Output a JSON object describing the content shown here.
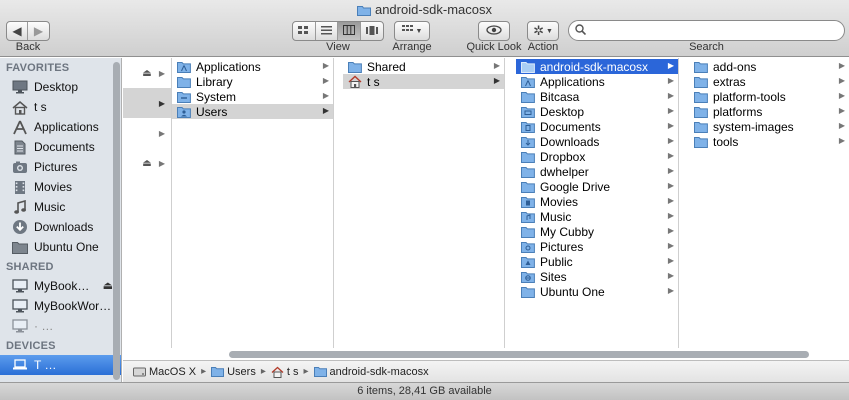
{
  "window": {
    "title": "android-sdk-macosx"
  },
  "toolbar": {
    "back_label": "Back",
    "view_label": "View",
    "arrange_label": "Arrange",
    "quicklook_label": "Quick Look",
    "action_label": "Action",
    "search_label": "Search",
    "search_placeholder": ""
  },
  "sidebar": {
    "favorites_header": "FAVORITES",
    "favorites": [
      {
        "label": "Desktop",
        "icon": "desktop-icon"
      },
      {
        "label": "t                 s",
        "icon": "home-icon"
      },
      {
        "label": "Applications",
        "icon": "applications-icon"
      },
      {
        "label": "Documents",
        "icon": "documents-icon"
      },
      {
        "label": "Pictures",
        "icon": "pictures-icon"
      },
      {
        "label": "Movies",
        "icon": "movies-icon"
      },
      {
        "label": "Music",
        "icon": "music-icon"
      },
      {
        "label": "Downloads",
        "icon": "downloads-icon"
      },
      {
        "label": "Ubuntu One",
        "icon": "folder-icon"
      }
    ],
    "shared_header": "SHARED",
    "shared": [
      {
        "label": "MyBook…",
        "icon": "computer-icon"
      },
      {
        "label": "MyBookWor…",
        "icon": "computer-icon"
      },
      {
        "label": "·            …",
        "icon": "computer-icon"
      }
    ],
    "devices_header": "DEVICES",
    "devices": [
      {
        "label": "T                …",
        "icon": "laptop-icon"
      }
    ]
  },
  "columns": {
    "volumes_arrow": "▶",
    "root": [
      "Applications",
      "Library",
      "System",
      "Users"
    ],
    "users": [
      "Shared",
      "t                 s"
    ],
    "home": [
      "android-sdk-macosx",
      "Applications",
      "Bitcasa",
      "Desktop",
      "Documents",
      "Downloads",
      "Dropbox",
      "dwhelper",
      "Google Drive",
      "Movies",
      "Music",
      "My Cubby",
      "Pictures",
      "Public",
      "Sites",
      "Ubuntu One"
    ],
    "sdk": [
      "add-ons",
      "extras",
      "platform-tools",
      "platforms",
      "system-images",
      "tools"
    ]
  },
  "pathbar": {
    "segments": [
      "MacOS X",
      "Users",
      "t                 s",
      "android-sdk-macosx"
    ]
  },
  "status": {
    "text": "6 items, 28,41 GB available"
  },
  "colors": {
    "selection": "#2b66d9",
    "sidebar_bg": "#dfe4ea",
    "folder": "#7fb2e8"
  }
}
